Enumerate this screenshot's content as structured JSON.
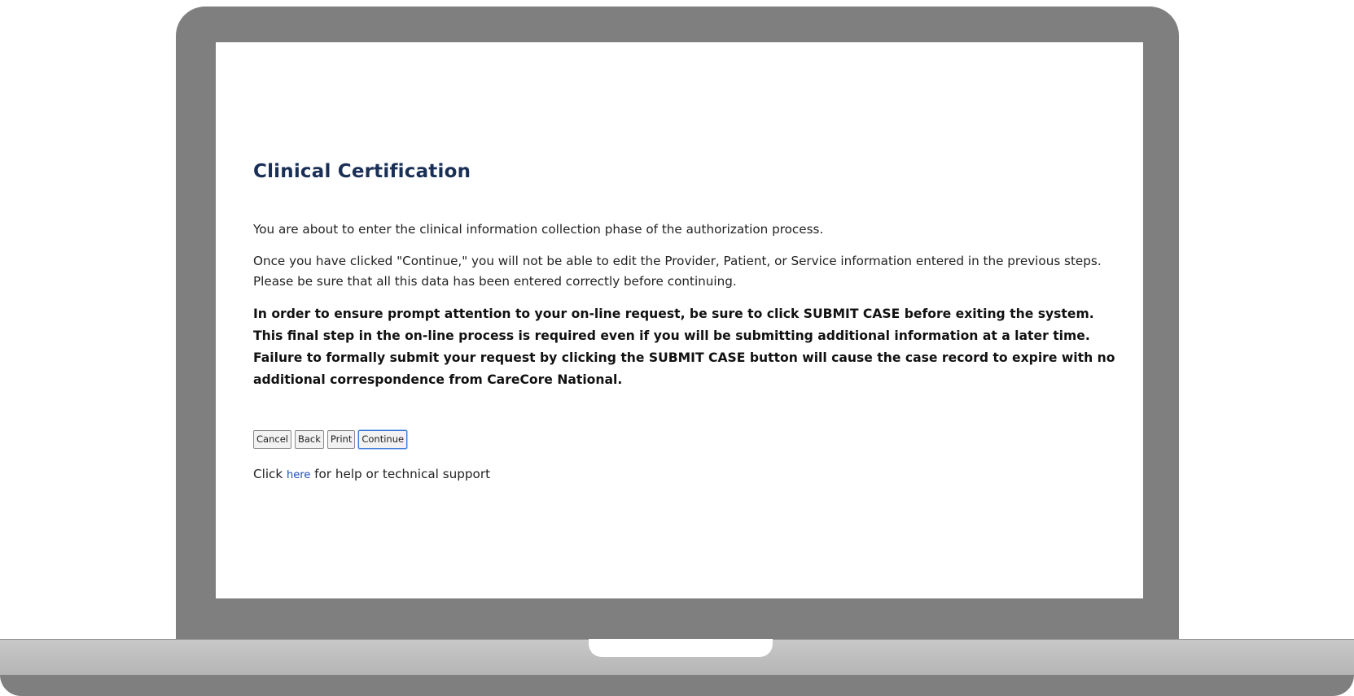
{
  "page": {
    "title": "Clinical Certification",
    "paragraphs": [
      "You are about to enter the clinical information collection phase of the authorization process.",
      "Once you have clicked \"Continue,\" you will not be able to edit the Provider, Patient, or Service information entered in the previous steps. Please be sure that all this data has been entered correctly before continuing.",
      "In order to ensure prompt attention to your on-line request, be sure to click SUBMIT CASE before exiting the system. This final step in the on-line process is required even if you will be submitting additional information at a later time. Failure to formally submit your request by clicking the SUBMIT CASE button will cause the case record to expire with no additional correspondence from CareCore National."
    ]
  },
  "buttons": {
    "cancel": "Cancel",
    "back": "Back",
    "print": "Print",
    "continue": "Continue"
  },
  "help": {
    "prefix": "Click ",
    "link": "here",
    "suffix": " for help or technical support"
  },
  "colors": {
    "title": "#1a2f55",
    "link": "#1f4db3",
    "bezel": "#7f7f7f",
    "primary_button_border": "#3d7bd9"
  }
}
